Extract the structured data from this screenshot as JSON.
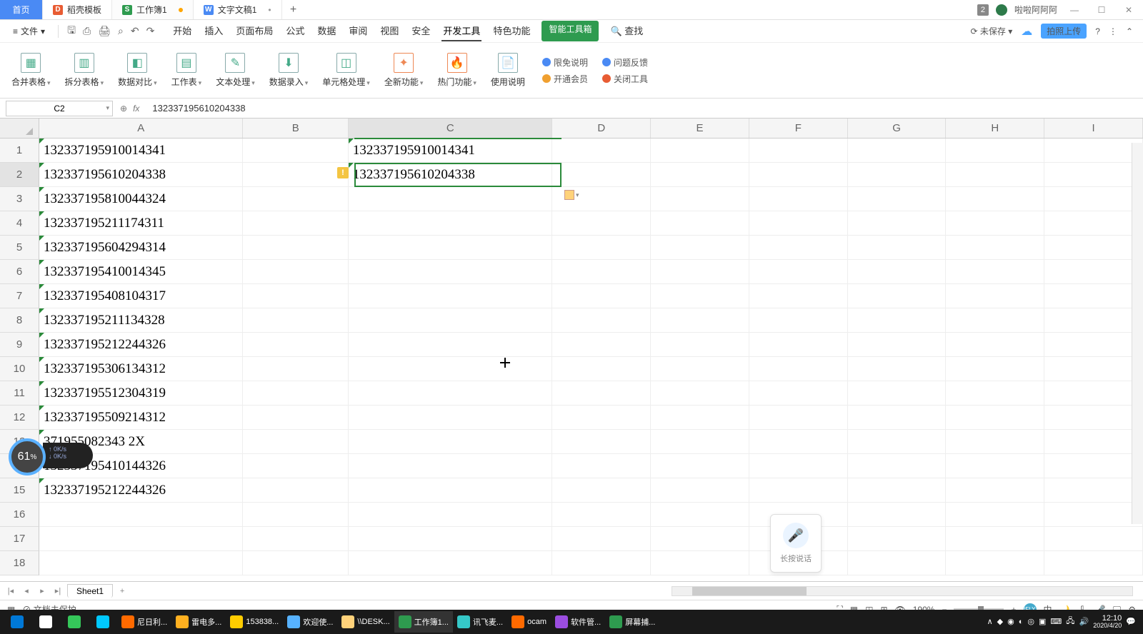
{
  "titlebar": {
    "tabs": [
      {
        "label": "首页",
        "icon": "home",
        "active": false
      },
      {
        "label": "稻壳模板",
        "icon": "D",
        "iconColor": "#e85c33"
      },
      {
        "label": "工作簿1",
        "icon": "S",
        "iconColor": "#2e9b4f",
        "dirty": true,
        "active": true
      },
      {
        "label": "文字文稿1",
        "icon": "W",
        "iconColor": "#4a8af4",
        "dirty": true
      }
    ],
    "badge": "2",
    "username": "啦啦阿阿阿"
  },
  "ribbon": {
    "file_label": "文件",
    "tabs": [
      "开始",
      "插入",
      "页面布局",
      "公式",
      "数据",
      "审阅",
      "视图",
      "安全",
      "开发工具",
      "特色功能"
    ],
    "active_tab": "开发工具",
    "toolbox": "智能工具箱",
    "search": "查找",
    "unsaved": "未保存",
    "cloud_upload": "拍照上传",
    "big_buttons": [
      {
        "label": "合并表格",
        "dd": true
      },
      {
        "label": "拆分表格",
        "dd": true
      },
      {
        "label": "数据对比",
        "dd": true
      },
      {
        "label": "工作表",
        "dd": true
      },
      {
        "label": "文本处理",
        "dd": true
      },
      {
        "label": "数据录入",
        "dd": true
      },
      {
        "label": "单元格处理",
        "dd": true
      },
      {
        "label": "全新功能",
        "dd": true
      },
      {
        "label": "热门功能",
        "dd": true
      },
      {
        "label": "使用说明",
        "dd": false
      }
    ],
    "side_links": [
      {
        "label": "限免说明",
        "color": "#4a8af4"
      },
      {
        "label": "开通会员",
        "color": "#f0a030"
      },
      {
        "label": "问题反馈",
        "color": "#4a8af4"
      },
      {
        "label": "关闭工具",
        "color": "#e85c33"
      }
    ]
  },
  "formula_bar": {
    "name_box": "C2",
    "fx": "fx",
    "value": "132337195610204338"
  },
  "columns": [
    "A",
    "B",
    "C",
    "D",
    "E",
    "F",
    "G",
    "H",
    "I"
  ],
  "rows_visible": 18,
  "active_cell": "C2",
  "data": {
    "A": [
      "132337195910014341",
      "132337195610204338",
      "132337195810044324",
      "132337195211174311",
      "132337195604294314",
      "132337195410014345",
      "132337195408104317",
      "132337195211134328",
      "132337195212244326",
      "132337195306134312",
      "132337195512304319",
      "132337195509214312",
      "  371955082343 2X",
      "132337195410144326",
      "132337195212244326"
    ],
    "C": [
      "132337195910014341",
      "132337195610204338"
    ]
  },
  "gauge": {
    "value": "61",
    "unit": "%",
    "net_up": "0K/s",
    "net_dn": "0K/s"
  },
  "voice_widget": {
    "label": "长按说话"
  },
  "sheet_tabs": {
    "active": "Sheet1"
  },
  "statusbar": {
    "doc_protect": "文档未保护",
    "zoom": "190%"
  },
  "taskbar": {
    "items": [
      {
        "label": "",
        "ic": "#0078d7"
      },
      {
        "label": "",
        "ic": "#fff"
      },
      {
        "label": "",
        "ic": "#35c75a"
      },
      {
        "label": "",
        "ic": "#00c8ff"
      },
      {
        "label": "尼日利...",
        "ic": "#ff6a00"
      },
      {
        "label": "雷电多...",
        "ic": "#ffb020"
      },
      {
        "label": "153838...",
        "ic": "#ffcc00"
      },
      {
        "label": "欢迎使...",
        "ic": "#57b2ff"
      },
      {
        "label": "\\\\DESK...",
        "ic": "#ffd27a"
      },
      {
        "label": "工作簿1...",
        "ic": "#2e9b4f",
        "running": true
      },
      {
        "label": "讯飞麦...",
        "ic": "#35c7c7"
      },
      {
        "label": "ocam",
        "ic": "#ff6a00"
      },
      {
        "label": "软件管...",
        "ic": "#9b4de0"
      },
      {
        "label": "屏幕捕...",
        "ic": "#2e9b4f"
      }
    ],
    "tray": "∧",
    "clock": "12:10",
    "date": "2020/4/20"
  }
}
